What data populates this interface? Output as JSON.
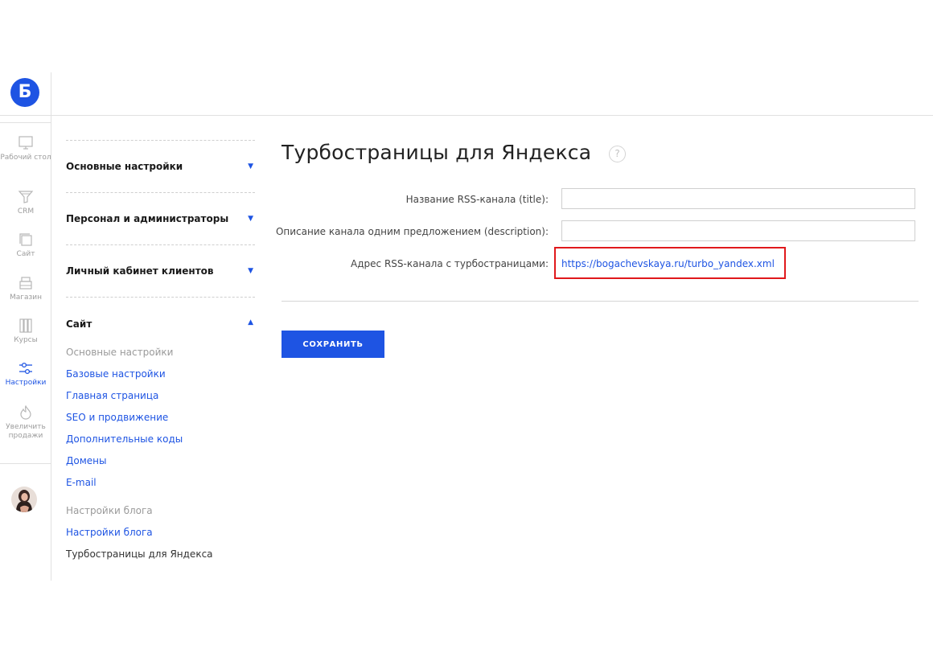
{
  "brand": {
    "logo_letter": "Б",
    "accent": "#1e54e3"
  },
  "rail": {
    "items": [
      {
        "label": "Рабочий стол",
        "icon": "monitor-icon"
      },
      {
        "label": "CRM",
        "icon": "funnel-icon"
      },
      {
        "label": "Сайт",
        "icon": "pages-icon"
      },
      {
        "label": "Магазин",
        "icon": "cash-register-icon"
      },
      {
        "label": "Курсы",
        "icon": "books-icon"
      },
      {
        "label": "Настройки",
        "icon": "sliders-icon",
        "active": true
      },
      {
        "label": "Увеличить продажи",
        "icon": "flame-icon"
      }
    ]
  },
  "sidebar": {
    "sections": [
      {
        "title": "Основные настройки",
        "expanded": false
      },
      {
        "title": "Персонал и администраторы",
        "expanded": false
      },
      {
        "title": "Личный кабинет клиентов",
        "expanded": false
      },
      {
        "title": "Сайт",
        "expanded": true
      }
    ],
    "site_group_title": "Основные настройки",
    "site_links": [
      "Базовые настройки",
      "Главная страница",
      "SEO и продвижение",
      "Дополнительные коды",
      "Домены",
      "E-mail"
    ],
    "blog_group_title": "Настройки блога",
    "blog_links": [
      "Настройки блога"
    ],
    "current_item": "Турбостраницы для Яндекса"
  },
  "main": {
    "title": "Турбостраницы для Яндекса",
    "help": "?",
    "fields": {
      "title_label": "Название RSS-канала (title):",
      "title_value": "",
      "description_label": "Описание канала одним предложением (description):",
      "description_value": "",
      "rss_label": "Адрес RSS-канала с турбостраницами:",
      "rss_url": "https://bogachevskaya.ru/turbo_yandex.xml"
    },
    "save_label": "СОХРАНИТЬ"
  }
}
